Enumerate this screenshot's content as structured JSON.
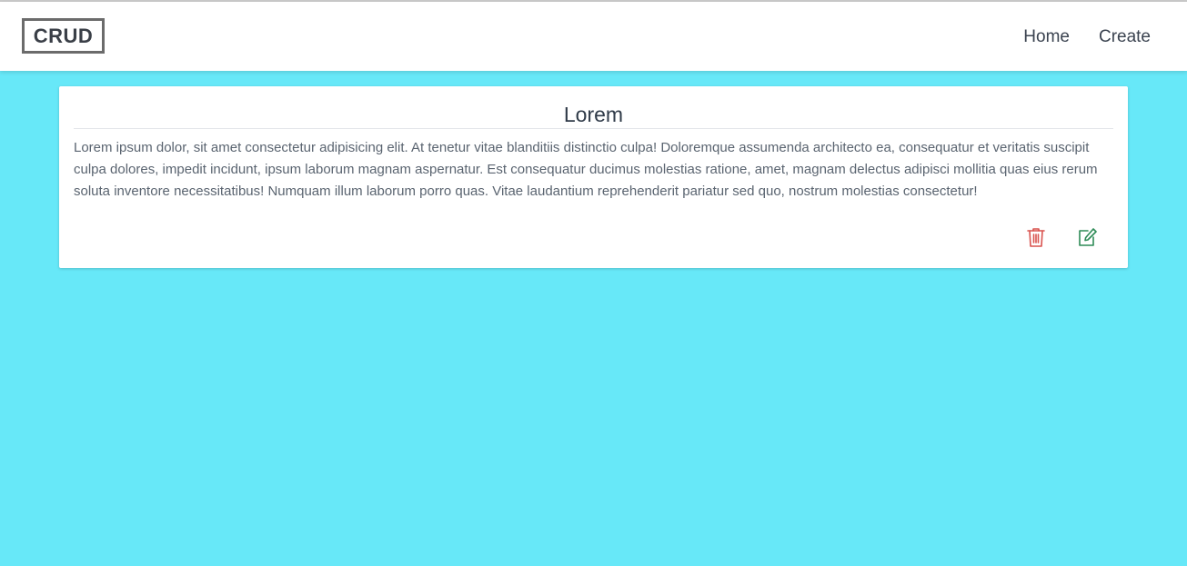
{
  "navbar": {
    "logo": "CRUD",
    "links": [
      {
        "label": "Home"
      },
      {
        "label": "Create"
      }
    ]
  },
  "post": {
    "title": "Lorem",
    "body": "Lorem ipsum dolor, sit amet consectetur adipisicing elit. At tenetur vitae blanditiis distinctio culpa! Doloremque assumenda architecto ea, consequatur et veritatis suscipit culpa dolores, impedit incidunt, ipsum laborum magnam aspernatur. Est consequatur ducimus molestias ratione, amet, magnam delectus adipisci mollitia quas eius rerum soluta inventore necessitatibus! Numquam illum laborum porro quas. Vitae laudantium reprehenderit pariatur sed quo, nostrum molestias consectetur!",
    "actions": {
      "delete_icon": "trash-icon",
      "edit_icon": "edit-icon"
    }
  },
  "colors": {
    "background": "#67e8f8",
    "delete": "#d9534f",
    "edit": "#2e8b57"
  }
}
